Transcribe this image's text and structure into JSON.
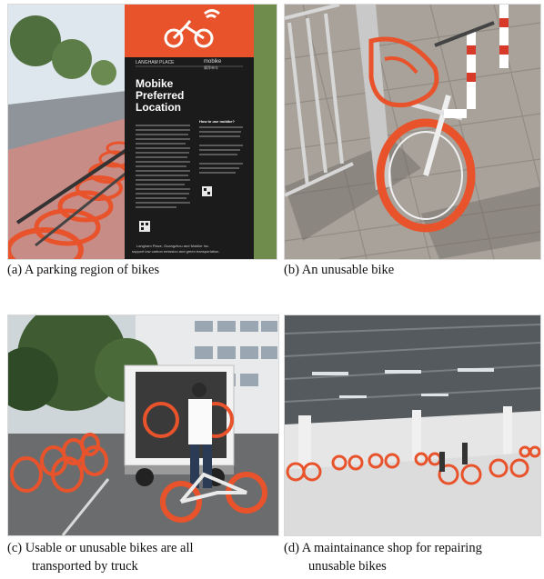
{
  "panels": [
    {
      "id": "a",
      "caption": "(a) A parking region of bikes",
      "sign": {
        "header_left": "LANGHAM PLACE",
        "header_right": "mobike",
        "header_right_sub": "摩拜单车",
        "title_line1": "Mobike",
        "title_line2": "Preferred",
        "title_line3": "Location",
        "howto_heading": "How to use mobike?",
        "footer_line1": "Langham Place, Guangzhou and Mobike Inc.",
        "footer_line2": "support low carbon emission and green transportation."
      }
    },
    {
      "id": "b",
      "caption": "(b) An unusable bike"
    },
    {
      "id": "c",
      "caption_line1": "(c) Usable or unusable bikes are all",
      "caption_line2": "transported by truck"
    },
    {
      "id": "d",
      "caption_line1": "(d) A maintainance shop for repairing",
      "caption_line2": "unusable bikes"
    }
  ],
  "colors": {
    "mobike_orange": "#e8532b",
    "sign_black": "#1b1b1b"
  }
}
